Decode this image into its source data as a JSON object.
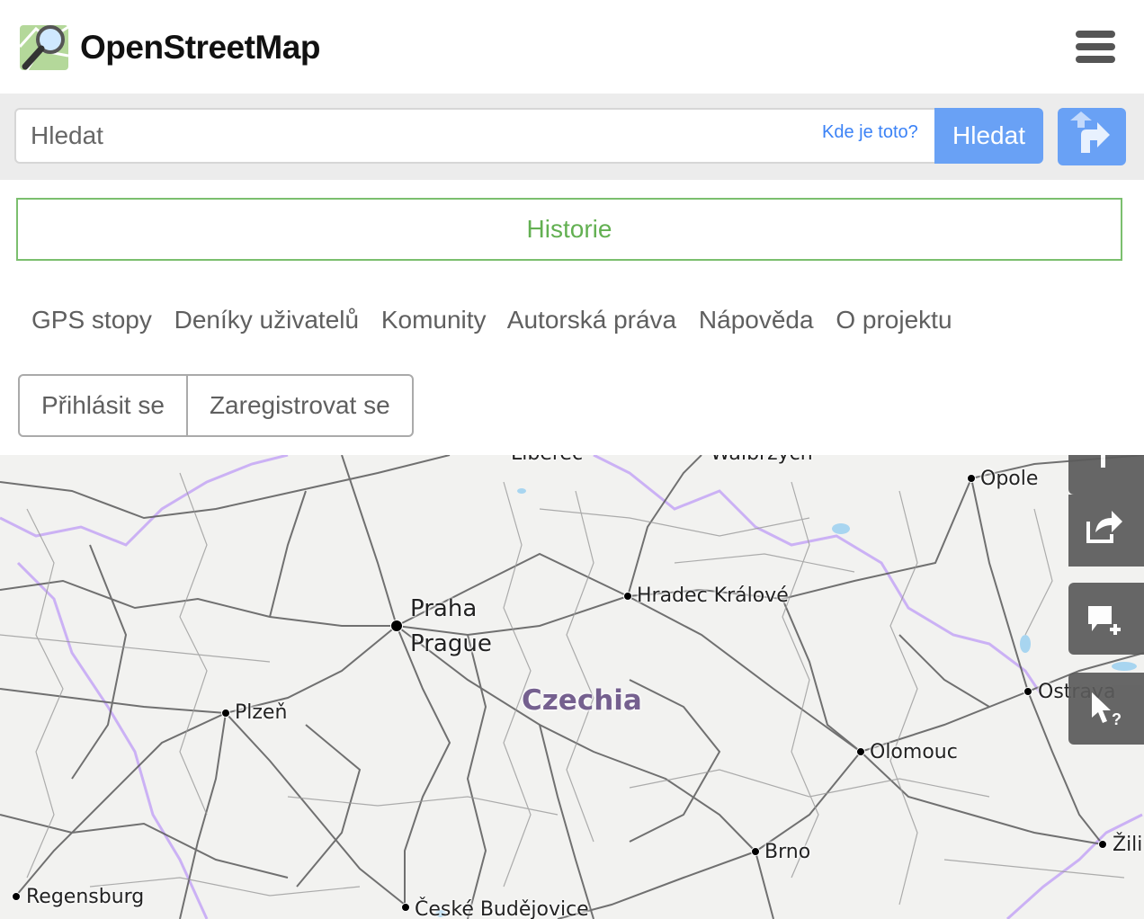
{
  "brand": {
    "name": "OpenStreetMap"
  },
  "search": {
    "placeholder": "Hledat",
    "where_link": "Kde je toto?",
    "button": "Hledat"
  },
  "history_button": "Historie",
  "nav": [
    "GPS stopy",
    "Deníky uživatelů",
    "Komunity",
    "Autorská práva",
    "Nápověda",
    "O projektu"
  ],
  "auth": {
    "login": "Přihlásit se",
    "register": "Zaregistrovat se"
  },
  "map": {
    "country": "Czechia",
    "cities": {
      "praha": "Praha",
      "prague": "Prague",
      "hradec": "Hradec Králové",
      "plzen": "Plzeň",
      "olomouc": "Olomouc",
      "ostrava": "Ostrava",
      "brno": "Brno",
      "opole": "Opole",
      "regensburg": "Regensburg",
      "budejovice": "České Budějovice",
      "zilina": "Žili",
      "liberec": "Liberec",
      "walbrzych": "Wałbrzych"
    }
  },
  "colors": {
    "accent": "#69a1f5",
    "history": "#63b052",
    "border_purple": "#c6a8ff"
  },
  "icons": {
    "logo": "osm-logo-icon",
    "menu": "hamburger-icon",
    "directions": "directions-icon",
    "share": "share-icon",
    "note": "add-note-icon",
    "query": "query-features-icon"
  }
}
